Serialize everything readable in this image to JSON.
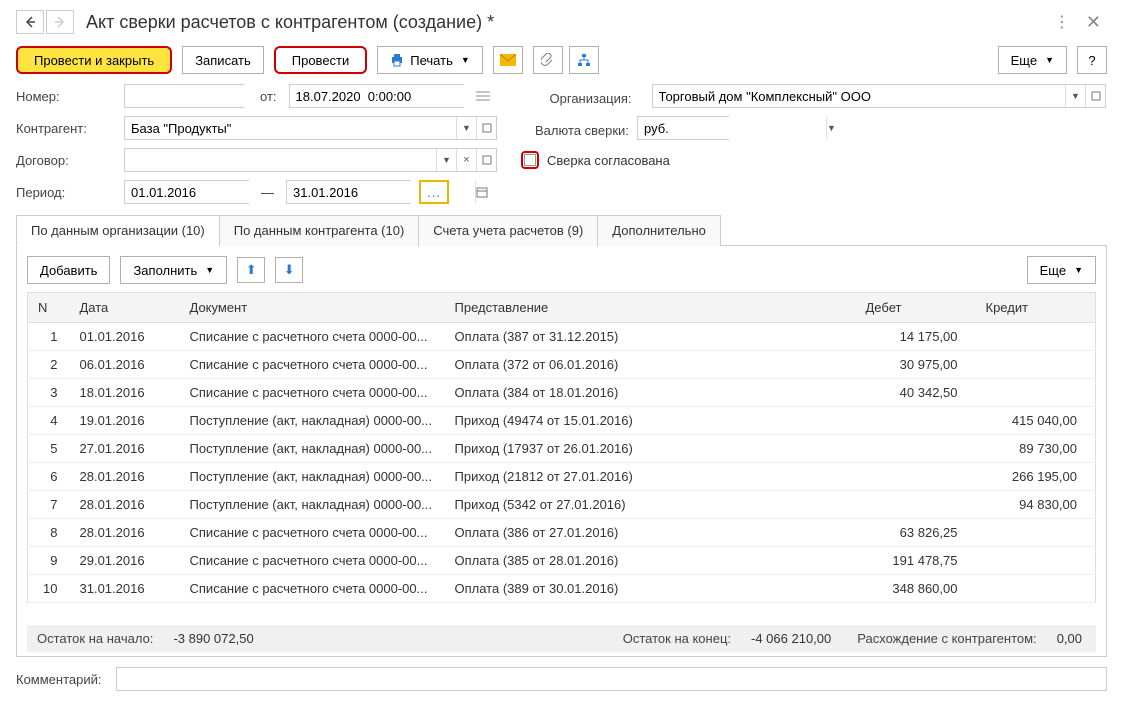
{
  "title": "Акт сверки расчетов с контрагентом (создание) *",
  "toolbar": {
    "conduct_close": "Провести и закрыть",
    "write": "Записать",
    "conduct": "Провести",
    "print": "Печать",
    "more": "Еще"
  },
  "fields": {
    "number_label": "Номер:",
    "number_value": "",
    "ot_label": "от:",
    "date_value": "18.07.2020  0:00:00",
    "org_label": "Организация:",
    "org_value": "Торговый дом \"Комплексный\" ООО",
    "counterparty_label": "Контрагент:",
    "counterparty_value": "База \"Продукты\"",
    "currency_label": "Валюта сверки:",
    "currency_value": "руб.",
    "contract_label": "Договор:",
    "contract_value": "",
    "agreed_label": "Сверка согласована",
    "period_label": "Период:",
    "period_from": "01.01.2016",
    "period_dash": "—",
    "period_to": "31.01.2016"
  },
  "tabs": {
    "t1": "По данным организации (10)",
    "t2": "По данным контрагента (10)",
    "t3": "Счета учета расчетов (9)",
    "t4": "Дополнительно"
  },
  "tab_toolbar": {
    "add": "Добавить",
    "fill": "Заполнить",
    "more": "Еще"
  },
  "columns": {
    "n": "N",
    "date": "Дата",
    "doc": "Документ",
    "repr": "Представление",
    "debit": "Дебет",
    "credit": "Кредит"
  },
  "rows": [
    {
      "n": "1",
      "date": "01.01.2016",
      "doc": "Списание с расчетного счета 0000-00...",
      "repr": "Оплата (387 от 31.12.2015)",
      "debit": "14 175,00",
      "credit": ""
    },
    {
      "n": "2",
      "date": "06.01.2016",
      "doc": "Списание с расчетного счета 0000-00...",
      "repr": "Оплата (372 от 06.01.2016)",
      "debit": "30 975,00",
      "credit": ""
    },
    {
      "n": "3",
      "date": "18.01.2016",
      "doc": "Списание с расчетного счета 0000-00...",
      "repr": "Оплата (384 от 18.01.2016)",
      "debit": "40 342,50",
      "credit": ""
    },
    {
      "n": "4",
      "date": "19.01.2016",
      "doc": "Поступление (акт, накладная) 0000-00...",
      "repr": "Приход (49474 от 15.01.2016)",
      "debit": "",
      "credit": "415 040,00"
    },
    {
      "n": "5",
      "date": "27.01.2016",
      "doc": "Поступление (акт, накладная) 0000-00...",
      "repr": "Приход (17937 от 26.01.2016)",
      "debit": "",
      "credit": "89 730,00"
    },
    {
      "n": "6",
      "date": "28.01.2016",
      "doc": "Поступление (акт, накладная) 0000-00...",
      "repr": "Приход (21812 от 27.01.2016)",
      "debit": "",
      "credit": "266 195,00"
    },
    {
      "n": "7",
      "date": "28.01.2016",
      "doc": "Поступление (акт, накладная) 0000-00...",
      "repr": "Приход (5342 от 27.01.2016)",
      "debit": "",
      "credit": "94 830,00"
    },
    {
      "n": "8",
      "date": "28.01.2016",
      "doc": "Списание с расчетного счета 0000-00...",
      "repr": "Оплата (386 от 27.01.2016)",
      "debit": "63 826,25",
      "credit": ""
    },
    {
      "n": "9",
      "date": "29.01.2016",
      "doc": "Списание с расчетного счета 0000-00...",
      "repr": "Оплата (385 от 28.01.2016)",
      "debit": "191 478,75",
      "credit": ""
    },
    {
      "n": "10",
      "date": "31.01.2016",
      "doc": "Списание с расчетного счета 0000-00...",
      "repr": "Оплата (389 от 30.01.2016)",
      "debit": "348 860,00",
      "credit": ""
    }
  ],
  "footer": {
    "start_label": "Остаток на начало:",
    "start_value": "-3 890 072,50",
    "end_label": "Остаток на конец:",
    "end_value": "-4 066 210,00",
    "diff_label": "Расхождение с контрагентом:",
    "diff_value": "0,00"
  },
  "comment_label": "Комментарий:",
  "help": "?"
}
